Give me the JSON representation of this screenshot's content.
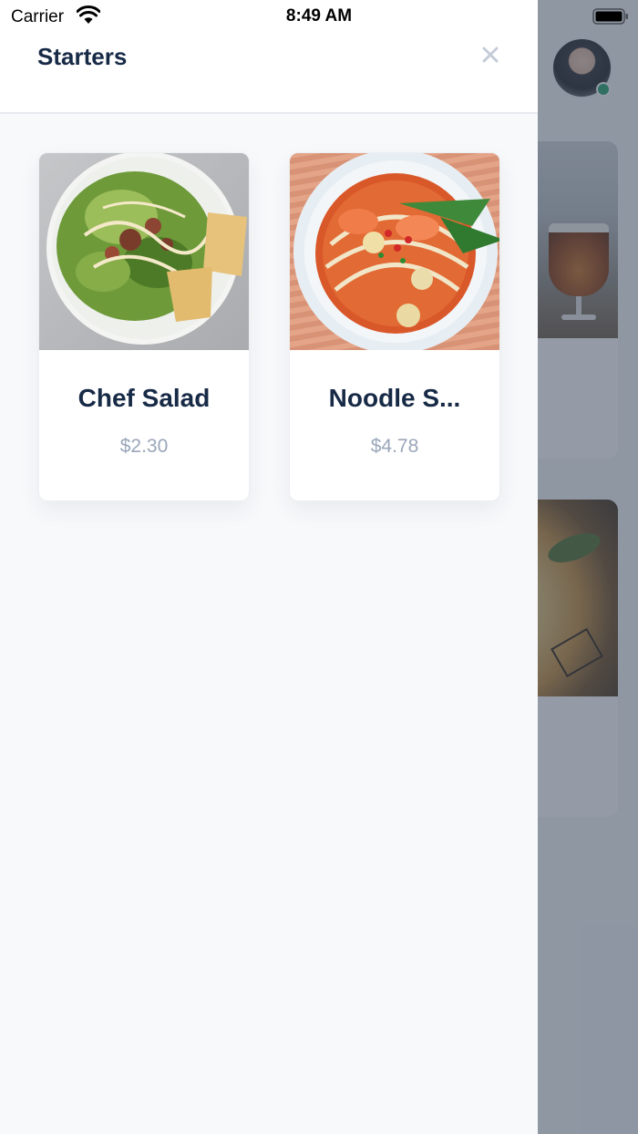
{
  "status_bar": {
    "carrier": "Carrier",
    "time": "8:49 AM"
  },
  "drawer": {
    "title": "Starters",
    "close_icon": "close-icon"
  },
  "items": [
    {
      "name": "Chef Salad",
      "price": "$2.30",
      "image": "salad-photo"
    },
    {
      "name": "Noodle S...",
      "price": "$4.78",
      "image": "noodle-soup-photo"
    }
  ],
  "colors": {
    "title": "#172a46",
    "price": "#9aa7ba",
    "online_status": "#22a06b"
  }
}
